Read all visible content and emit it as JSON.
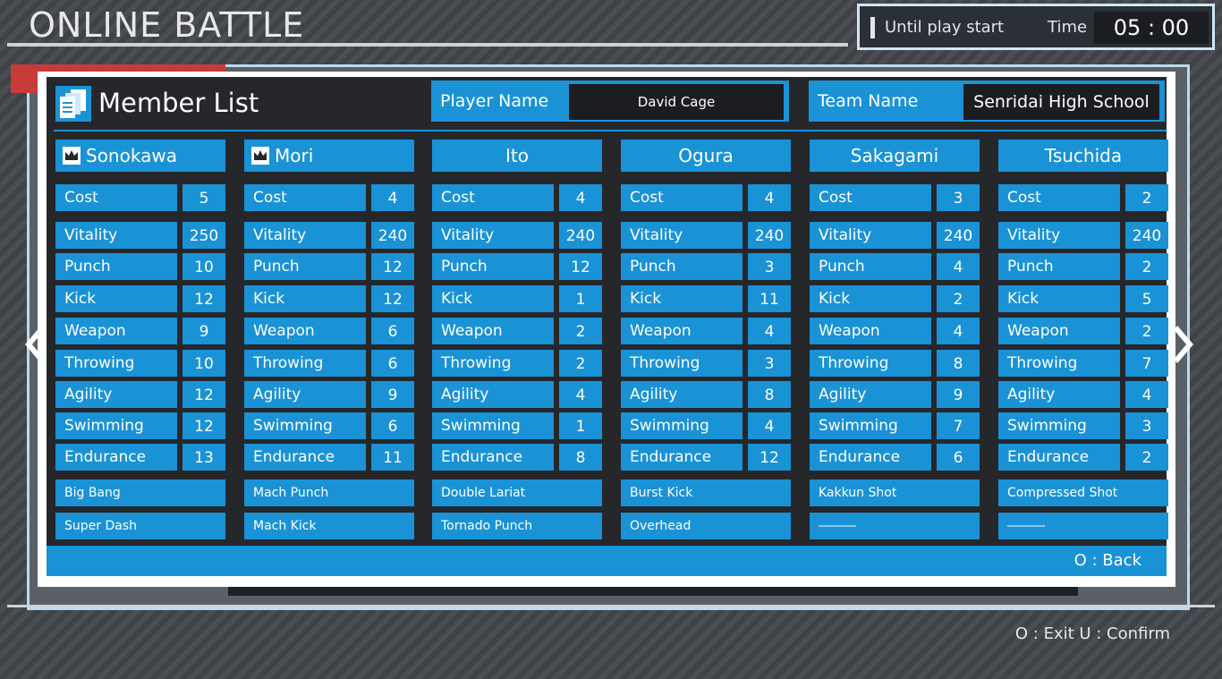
{
  "screen": {
    "title": "ONLINE BATTLE"
  },
  "timer": {
    "label": "Until play start",
    "time_label": "Time",
    "time_value": "05 : 00"
  },
  "modal": {
    "title": "Member List",
    "player_label": "Player Name",
    "player_value": "David Cage",
    "team_label": "Team Name",
    "team_value": "Senridai High School",
    "back_hint": "O : Back"
  },
  "stat_labels": [
    "Cost",
    "Vitality",
    "Punch",
    "Kick",
    "Weapon",
    "Throwing",
    "Agility",
    "Swimming",
    "Endurance"
  ],
  "members": [
    {
      "name": "Sonokawa",
      "leader": true,
      "stats": [
        "5",
        "250",
        "10",
        "12",
        "9",
        "10",
        "12",
        "12",
        "13"
      ],
      "skills": [
        "Big Bang",
        "Super Dash"
      ]
    },
    {
      "name": "Mori",
      "leader": true,
      "stats": [
        "4",
        "240",
        "12",
        "12",
        "6",
        "6",
        "9",
        "6",
        "11"
      ],
      "skills": [
        "Mach Punch",
        "Mach Kick"
      ]
    },
    {
      "name": "Ito",
      "leader": false,
      "stats": [
        "4",
        "240",
        "12",
        "1",
        "2",
        "2",
        "4",
        "1",
        "8"
      ],
      "skills": [
        "Double Lariat",
        "Tornado Punch"
      ]
    },
    {
      "name": "Ogura",
      "leader": false,
      "stats": [
        "4",
        "240",
        "3",
        "11",
        "4",
        "3",
        "8",
        "4",
        "12"
      ],
      "skills": [
        "Burst Kick",
        "Overhead"
      ]
    },
    {
      "name": "Sakagami",
      "leader": false,
      "stats": [
        "3",
        "240",
        "4",
        "2",
        "4",
        "8",
        "9",
        "7",
        "6"
      ],
      "skills": [
        "Kakkun Shot",
        "―――"
      ]
    },
    {
      "name": "Tsuchida",
      "leader": false,
      "stats": [
        "2",
        "240",
        "2",
        "5",
        "2",
        "7",
        "4",
        "3",
        "2"
      ],
      "skills": [
        "Compressed Shot",
        "―――"
      ]
    }
  ],
  "footer": {
    "hint": "O : Exit  U : Confirm"
  },
  "icons": {
    "document": "document-stack-icon",
    "crown": "crown-icon",
    "left": "chevron-left-icon",
    "right": "chevron-right-icon"
  },
  "colors": {
    "accent": "#1a92d6",
    "panel": "#25272b",
    "field": "#1b1d21"
  }
}
